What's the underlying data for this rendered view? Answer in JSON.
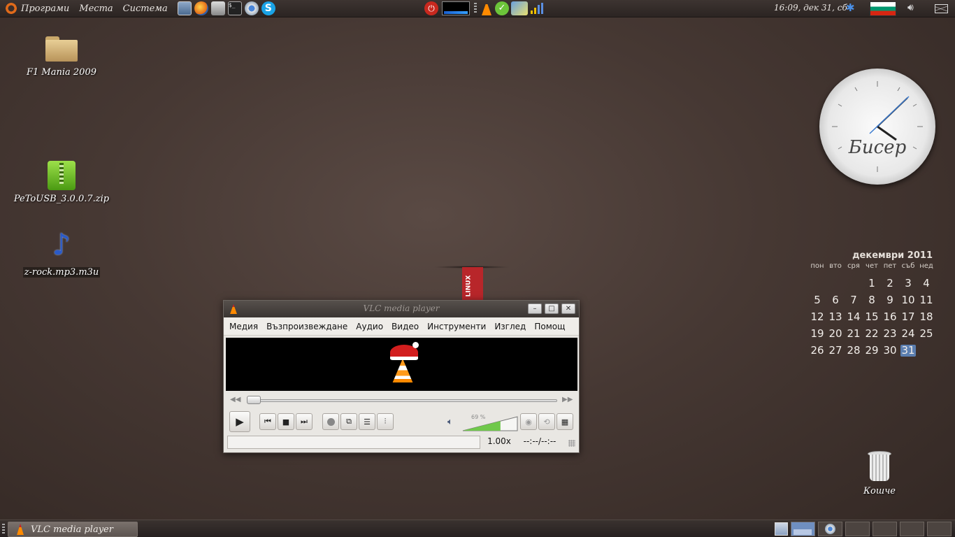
{
  "top_panel": {
    "menus": [
      "Програми",
      "Места",
      "Система"
    ],
    "launchers": [
      "monitor-icon",
      "firefox-icon",
      "scanner-icon",
      "terminal-icon",
      "chromium-icon",
      "skype-icon"
    ],
    "clock": "16:09, дек 31, сб"
  },
  "desktop": {
    "icons": [
      {
        "label": "F1 Mania 2009",
        "icon": "folder-icon"
      },
      {
        "label": "PeToUSB_3.0.0.7.zip",
        "icon": "zip-archive-icon"
      },
      {
        "label": "z-rock.mp3.m3u",
        "icon": "music-note-icon"
      },
      {
        "label": "Кошче",
        "icon": "trash-icon"
      }
    ],
    "clock_widget_label": "Бисер",
    "ribbon_label": "LINUX"
  },
  "calendar": {
    "title": "декември 2011",
    "weekdays": [
      "пон",
      "вто",
      "сря",
      "чет",
      "пет",
      "съб",
      "нед"
    ],
    "weeks": [
      [
        "",
        "",
        "",
        "1",
        "2",
        "3",
        "4"
      ],
      [
        "5",
        "6",
        "7",
        "8",
        "9",
        "10",
        "11"
      ],
      [
        "12",
        "13",
        "14",
        "15",
        "16",
        "17",
        "18"
      ],
      [
        "19",
        "20",
        "21",
        "22",
        "23",
        "24",
        "25"
      ],
      [
        "26",
        "27",
        "28",
        "29",
        "30",
        "31",
        ""
      ]
    ],
    "today": "31"
  },
  "vlc": {
    "title": "VLC media player",
    "menu": [
      "Медия",
      "Възпроизвеждане",
      "Аудио",
      "Видео",
      "Инструменти",
      "Изглед",
      "Помощ"
    ],
    "volume": "69 %",
    "volume_fraction": 0.69,
    "speed": "1.00x",
    "time": "--:--/--:--"
  },
  "taskbar": {
    "vlc_label": "VLC media player"
  }
}
